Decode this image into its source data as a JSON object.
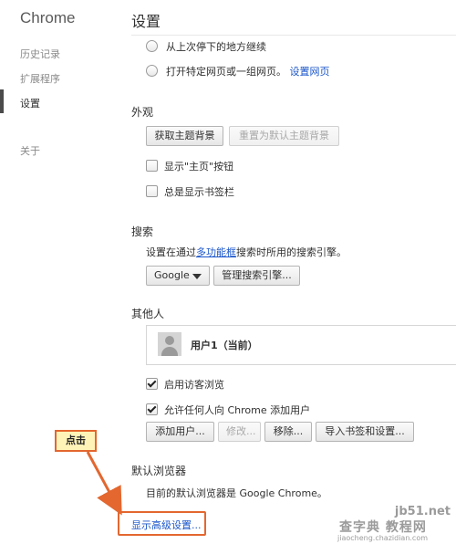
{
  "sidebar": {
    "brand": "Chrome",
    "items": [
      {
        "label": "历史记录"
      },
      {
        "label": "扩展程序"
      },
      {
        "label": "设置"
      },
      {
        "label": "关于"
      }
    ]
  },
  "main": {
    "title": "设置",
    "startup": {
      "options": [
        {
          "label": "从上次停下的地方继续"
        },
        {
          "label": "打开特定网页或一组网页。",
          "link": "设置网页"
        }
      ]
    },
    "appearance": {
      "title": "外观",
      "get_theme_button": "获取主题背景",
      "reset_theme_button": "重置为默认主题背景",
      "show_home_label": "显示\"主页\"按钮",
      "show_bookmarks_label": "总是显示书签栏"
    },
    "search": {
      "title": "搜索",
      "desc_prefix": "设置在通过",
      "desc_link": "多功能框",
      "desc_suffix": "搜索时所用的搜索引擎。",
      "engine_selected": "Google",
      "manage_button": "管理搜索引擎..."
    },
    "people": {
      "title": "其他人",
      "profile_name": "用户1（当前）",
      "guest_label": "启用访客浏览",
      "guest_checked": true,
      "allow_add_label": "允许任何人向 Chrome 添加用户",
      "allow_add_checked": true,
      "buttons": {
        "add": "添加用户...",
        "edit": "修改...",
        "remove": "移除...",
        "import": "导入书签和设置..."
      }
    },
    "default_browser": {
      "title": "默认浏览器",
      "desc": "目前的默认浏览器是 Google Chrome。"
    },
    "advanced_link": "显示高级设置..."
  },
  "annotation": {
    "callout_label": "点击",
    "accent_color": "#e3672f"
  },
  "watermark": {
    "line1": "jb51.net",
    "line2": "查字典 教程网",
    "line3": "jiaocheng.chazidian.com"
  }
}
